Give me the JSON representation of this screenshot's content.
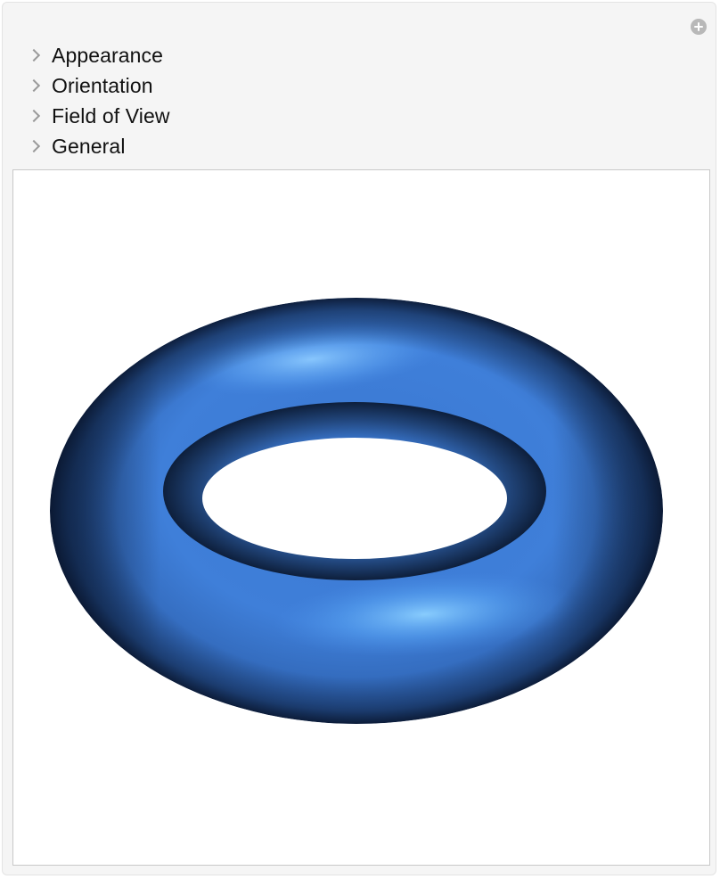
{
  "panel": {
    "expand_icon": "plus-circle-icon",
    "sections": [
      {
        "label": "Appearance",
        "icon": "chevron-right-icon",
        "expanded": false
      },
      {
        "label": "Orientation",
        "icon": "chevron-right-icon",
        "expanded": false
      },
      {
        "label": "Field of View",
        "icon": "chevron-right-icon",
        "expanded": false
      },
      {
        "label": "General",
        "icon": "chevron-right-icon",
        "expanded": false
      }
    ]
  },
  "viewport": {
    "object": "torus",
    "colors": {
      "surface": "#3f7fd9",
      "highlight": "#7cc0ff",
      "shadow": "#0d1f3d"
    }
  }
}
